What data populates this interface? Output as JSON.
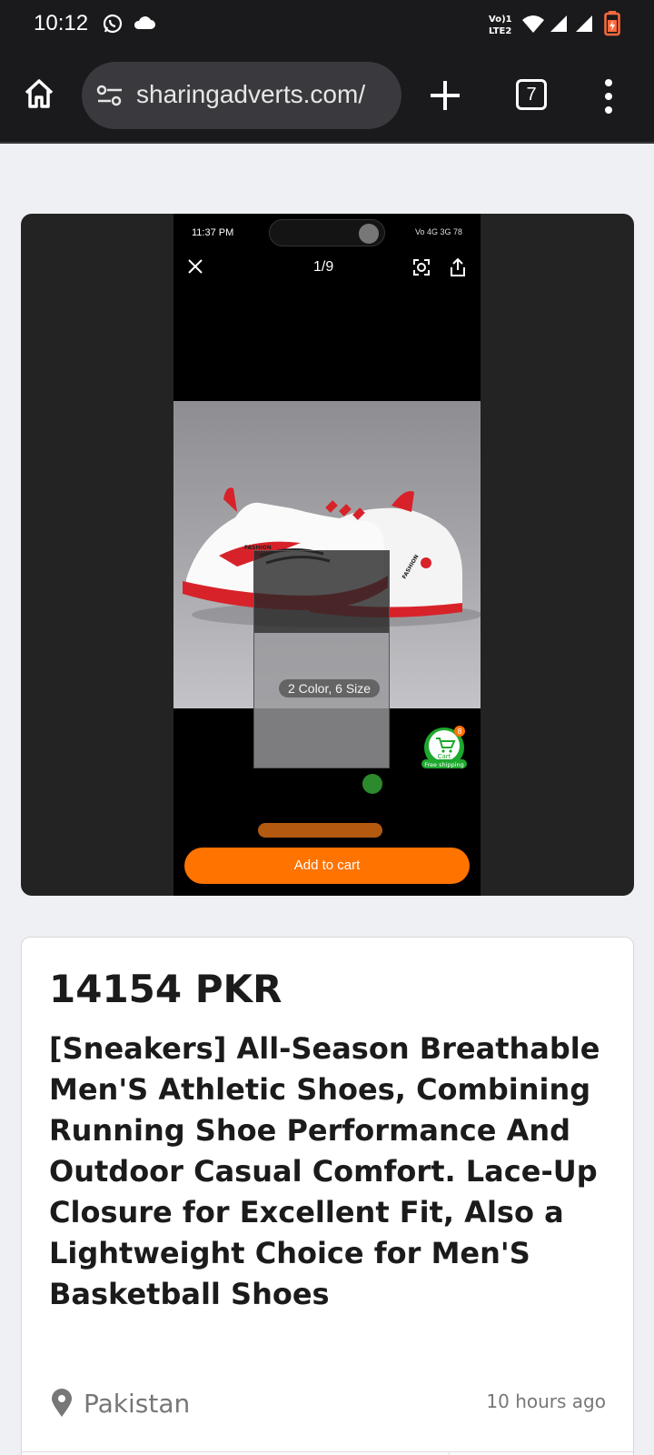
{
  "status_bar": {
    "time": "10:12",
    "icons": [
      "whatsapp-icon",
      "cloud-icon",
      "volte-icon",
      "wifi-icon",
      "signal-icon",
      "signal-icon",
      "battery-icon"
    ],
    "volte_label": "Vo)) 1\nLTE2"
  },
  "browser": {
    "url": "sharingadverts.com/",
    "tab_count": "7"
  },
  "screenshot": {
    "time": "11:37 PM",
    "indicators": "Vo 4G 3G 78",
    "counter": "1/9",
    "color_size": "2 Color, 6 Size",
    "cart_count": "8",
    "cart_label": "Cart",
    "free_shipping": "Free shipping",
    "add_to_cart": "Add to cart",
    "shoe_brand_1": "FASHION",
    "shoe_brand_2": "FASHION"
  },
  "listing": {
    "price": "14154 PKR",
    "title": "[Sneakers] All-Season Breathable Men'S Athletic Shoes, Combining Running Shoe Performance And Outdoor Casual Comfort. Lace-Up Closure for Excellent Fit, Also a Lightweight Choice for Men'S Basketball Shoes",
    "location": "Pakistan",
    "posted": "10 hours ago"
  },
  "colors": {
    "status_bg": "#1a1a1c",
    "url_pill": "#3a3a3e",
    "page_bg": "#eff0f4",
    "accent_orange": "#ff7300",
    "cart_green": "#1ea82e",
    "shoe_red": "#d8222a"
  }
}
